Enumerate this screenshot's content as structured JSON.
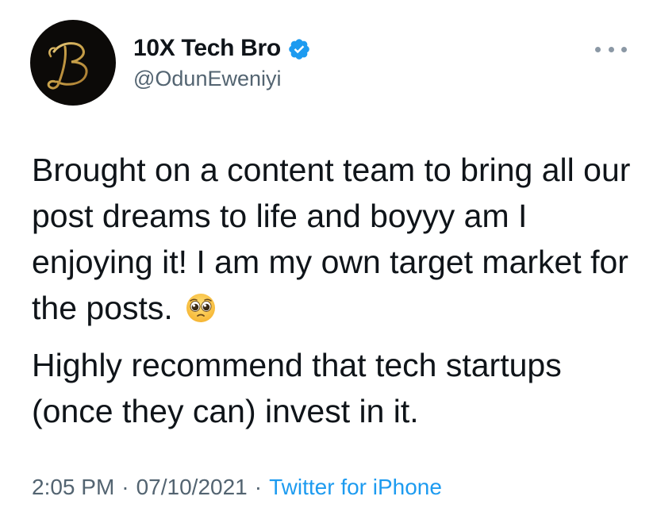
{
  "author": {
    "display_name": "10X Tech Bro",
    "handle": "@OdunEweniyi",
    "verified": true,
    "avatar_letter": "B",
    "avatar_icon": "gold-script-b-monogram"
  },
  "menu": {
    "icon": "more-horizontal-icon"
  },
  "tweet": {
    "paragraphs": [
      "Brought on a content team to bring all our post dreams to life and boyyy am I enjoying it! I am my own target market for the posts.",
      "Highly recommend that tech startups (once they can) invest in it."
    ],
    "emoji": "pleading-face-emoji"
  },
  "meta": {
    "time": "2:05 PM",
    "separator": "·",
    "date": "07/10/2021",
    "source": "Twitter for iPhone"
  },
  "colors": {
    "text": "#0f1419",
    "secondary": "#536471",
    "accent": "#1d9bf0",
    "avatar_bg": "#0c0a08",
    "avatar_gold": "#c9a24a"
  }
}
